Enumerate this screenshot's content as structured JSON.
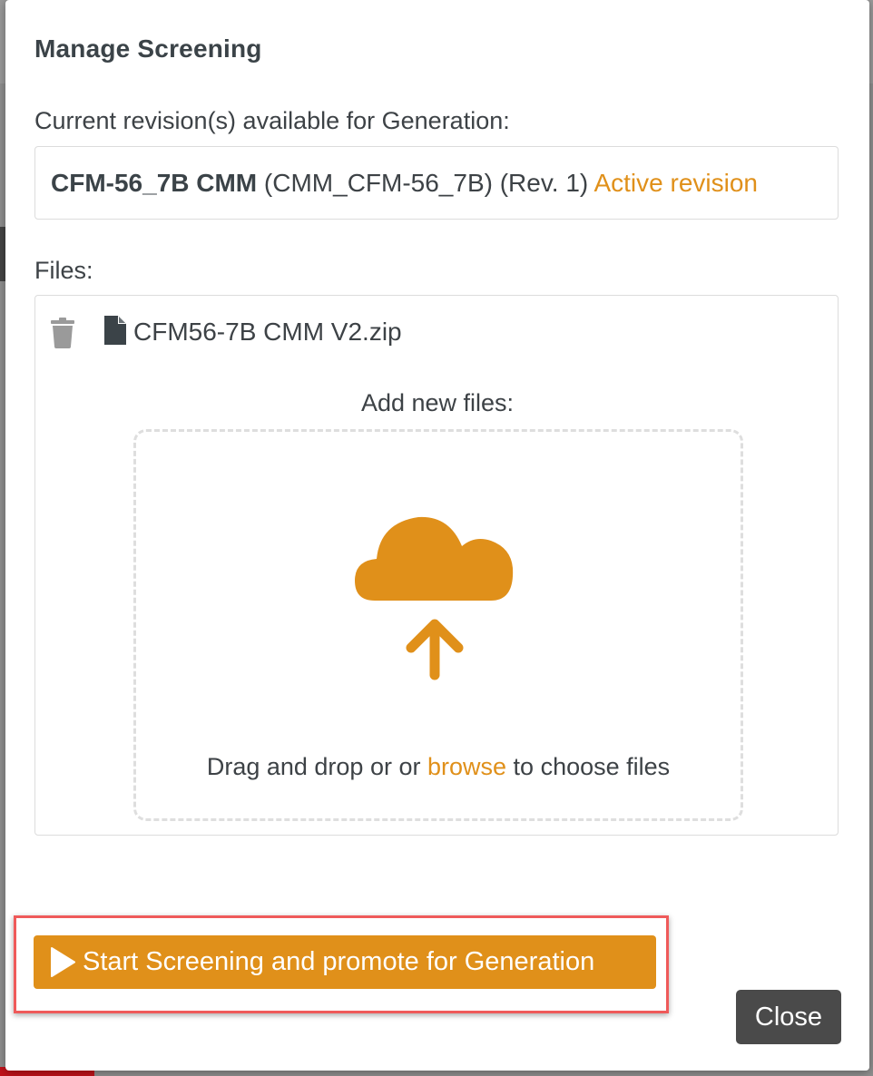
{
  "modal": {
    "title": "Manage Screening",
    "revision_label": "Current revision(s) available for Generation:",
    "revision": {
      "name": "CFM-56_7B CMM",
      "code": "(CMM_CFM-56_7B)",
      "rev": "(Rev. 1)",
      "status": "Active revision"
    },
    "files_label": "Files:",
    "files": [
      {
        "name": "CFM56-7B CMM V2.zip",
        "delete_icon": "trash-icon",
        "type_icon": "file-icon"
      }
    ],
    "dropzone": {
      "add_label": "Add new files:",
      "icon": "cloud-upload-icon",
      "text_before": "Drag and drop or or",
      "link": "browse",
      "text_after": "to choose files"
    },
    "actions": {
      "primary_icon": "play-icon",
      "primary_label": "Start Screening and promote for Generation",
      "close_label": "Close"
    }
  },
  "colors": {
    "accent": "#e0901a",
    "text": "#3d4246",
    "close_bg": "#4a4a4a",
    "highlight_border": "#ef5a5a"
  }
}
